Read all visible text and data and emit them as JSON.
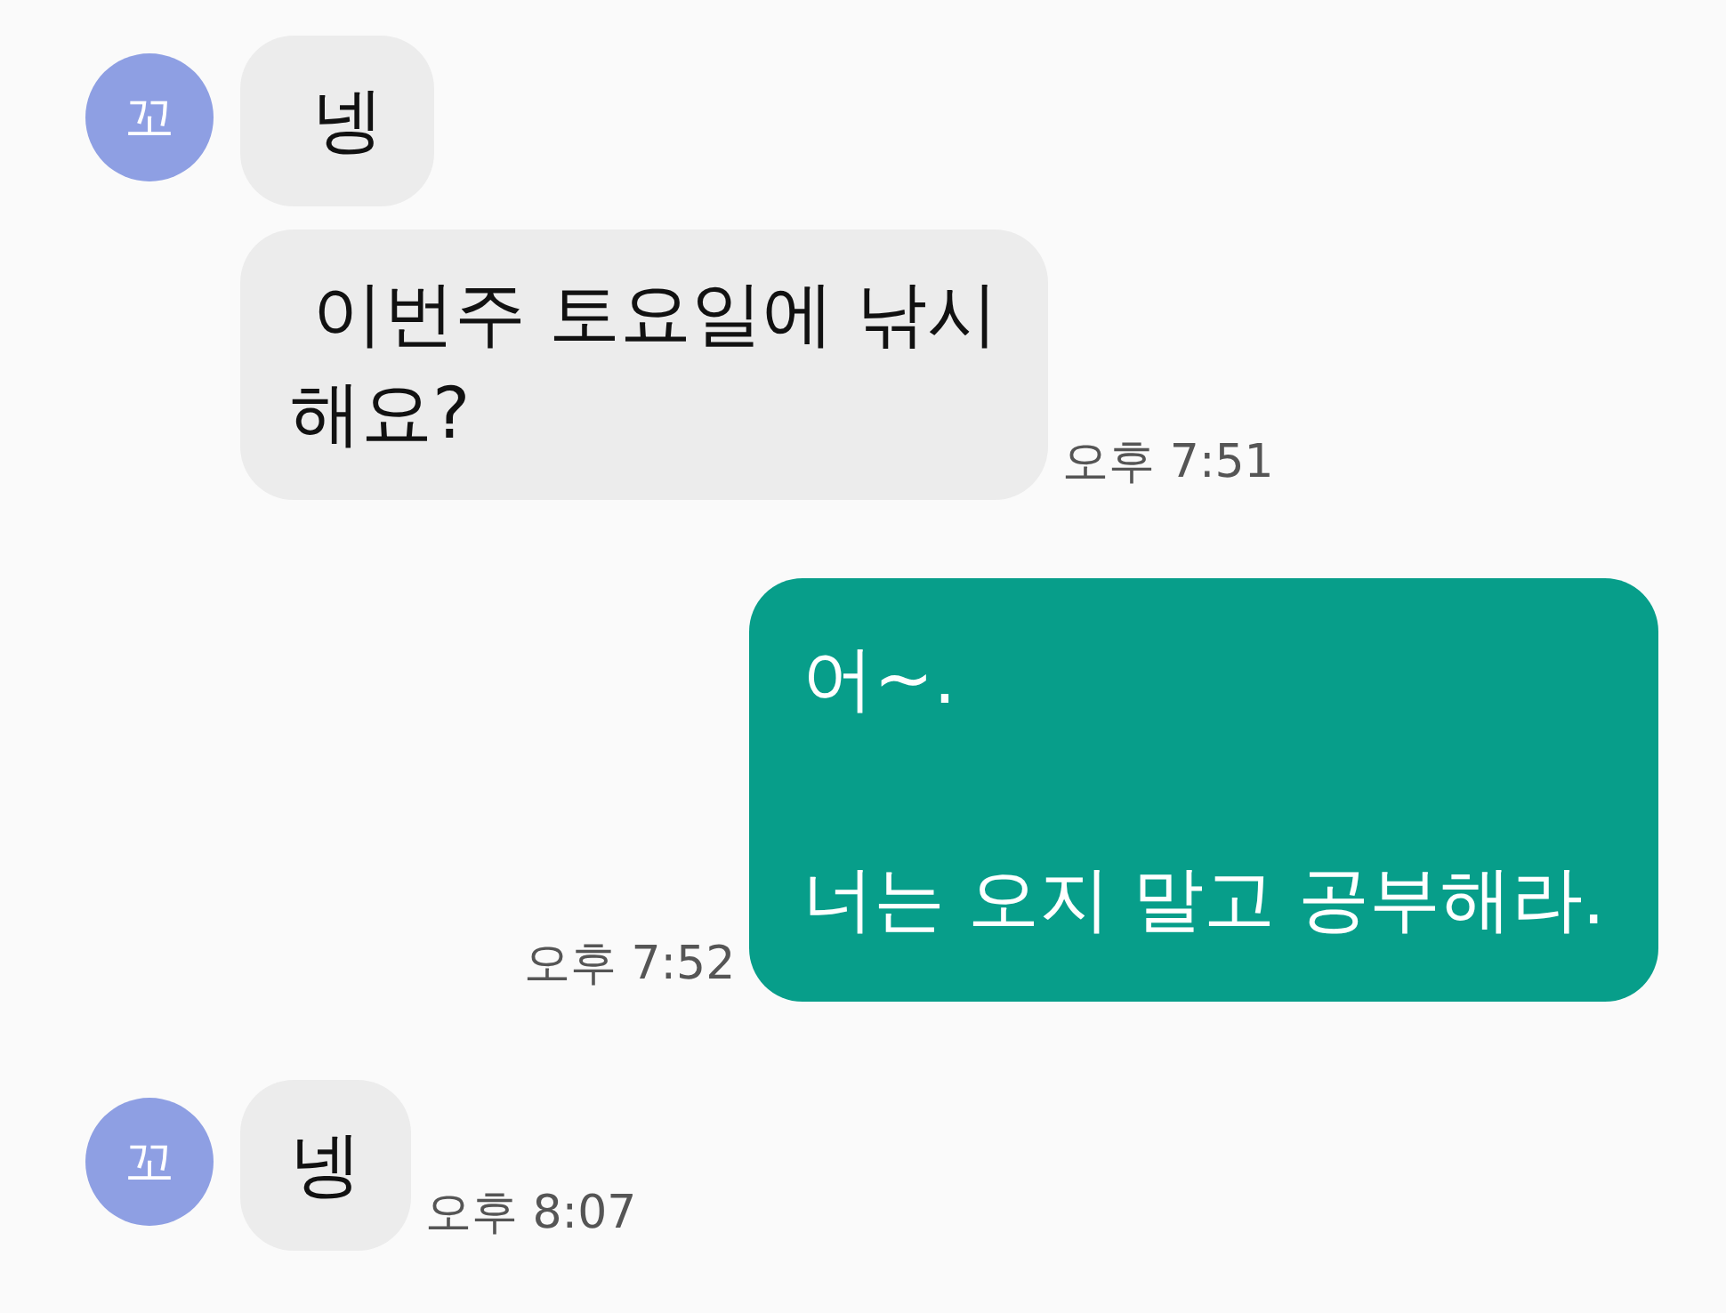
{
  "messages": [
    {
      "kind": "incoming",
      "avatar": "꼬",
      "text": " 넹"
    },
    {
      "kind": "incoming",
      "text": " 이번주 토요일에 낚시\n해요?",
      "time": "오후 7:51"
    },
    {
      "kind": "outgoing",
      "text": "어~.\n\n너는 오지 말고 공부해라.",
      "time": "오후 7:52"
    },
    {
      "kind": "incoming",
      "avatar": "꼬",
      "text": "넹",
      "time": "오후 8:07"
    }
  ]
}
